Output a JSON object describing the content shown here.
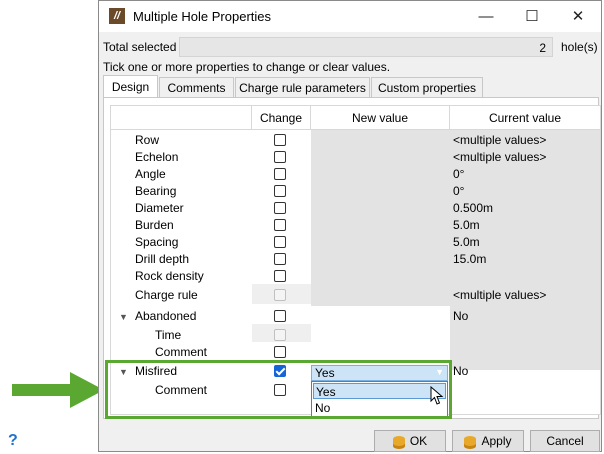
{
  "window": {
    "title": "Multiple Hole Properties",
    "minimize": "—",
    "maximize": "☐",
    "close": "✕"
  },
  "summary": {
    "total_label": "Total selected",
    "total_value": "2",
    "unit": "hole(s)",
    "instruction": "Tick one or more properties to change or clear values."
  },
  "tabs": [
    "Design",
    "Comments",
    "Charge rule parameters",
    "Custom properties"
  ],
  "table": {
    "headers": {
      "change": "Change",
      "new_value": "New value",
      "current_value": "Current value"
    },
    "rows": [
      {
        "label": "Row",
        "current": "<multiple values>"
      },
      {
        "label": "Echelon",
        "current": "<multiple values>"
      },
      {
        "label": "Angle",
        "current": "0°"
      },
      {
        "label": "Bearing",
        "current": "0°"
      },
      {
        "label": "Diameter",
        "current": "0.500m"
      },
      {
        "label": "Burden",
        "current": "5.0m"
      },
      {
        "label": "Spacing",
        "current": "5.0m"
      },
      {
        "label": "Drill depth",
        "current": "15.0m"
      },
      {
        "label": "Rock density",
        "current": ""
      },
      {
        "label": "Charge rule",
        "current": "<multiple values>"
      },
      {
        "label": "Abandoned",
        "current": "No"
      },
      {
        "label": "Time",
        "current": ""
      },
      {
        "label": "Comment",
        "current": ""
      },
      {
        "label": "Misfired",
        "current": "No"
      },
      {
        "label": "Comment",
        "current": ""
      }
    ]
  },
  "combo": {
    "selected": "Yes",
    "options": [
      "Yes",
      "No"
    ]
  },
  "buttons": {
    "ok": "OK",
    "apply": "Apply",
    "cancel": "Cancel"
  },
  "help": "?",
  "colors": {
    "highlight": "#5aa832",
    "selection": "#cde4f7",
    "checkbox_checked": "#1565d8"
  }
}
